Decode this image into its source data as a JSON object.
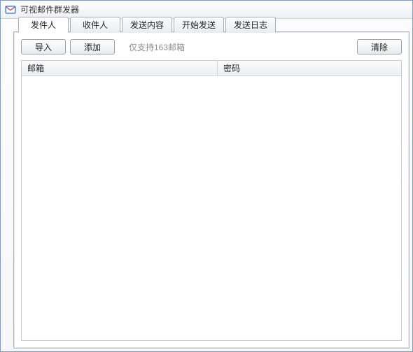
{
  "window": {
    "title": "可视邮件群发器"
  },
  "tabs": [
    {
      "label": "发件人",
      "active": true
    },
    {
      "label": "收件人",
      "active": false
    },
    {
      "label": "发送内容",
      "active": false
    },
    {
      "label": "开始发送",
      "active": false
    },
    {
      "label": "发送日志",
      "active": false
    }
  ],
  "toolbar": {
    "import_label": "导入",
    "add_label": "添加",
    "hint": "仅支持163邮箱",
    "clear_label": "清除"
  },
  "columns": {
    "email": "邮箱",
    "password": "密码"
  },
  "rows": []
}
